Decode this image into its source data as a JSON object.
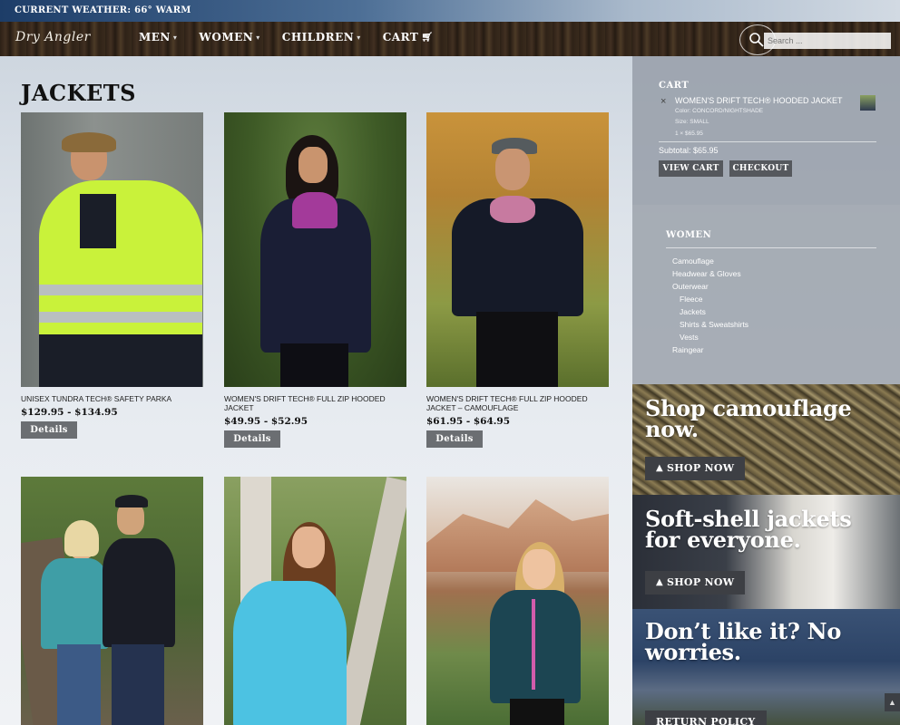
{
  "weather": {
    "text": "CURRENT WEATHER: 66° WARM"
  },
  "header": {
    "logo": "Dry Angler",
    "nav": [
      {
        "label": "MEN",
        "caret": "›"
      },
      {
        "label": "WOMEN",
        "caret": "›"
      },
      {
        "label": "CHILDREN",
        "caret": "›"
      },
      {
        "label": "CART",
        "caret": ""
      }
    ],
    "search_placeholder": "Search ..."
  },
  "main": {
    "title": "JACKETS",
    "products": [
      {
        "name": "UNISEX TUNDRA TECH® SAFETY PARKA",
        "price": "$129.95 - $134.95",
        "button": "Details"
      },
      {
        "name": "WOMEN'S DRIFT TECH® FULL ZIP HOODED JACKET",
        "price": "$49.95 - $52.95",
        "button": "Details"
      },
      {
        "name": "WOMEN'S DRIFT TECH® FULL ZIP HOODED JACKET – CAMOUFLAGE",
        "price": "$61.95 - $64.95",
        "button": "Details"
      },
      {
        "name": "",
        "price": "",
        "button": ""
      },
      {
        "name": "",
        "price": "",
        "button": ""
      },
      {
        "name": "",
        "price": "",
        "button": ""
      }
    ]
  },
  "cart_widget": {
    "title": "CART",
    "remove": "×",
    "item_name": "WOMEN'S DRIFT TECH® HOODED JACKET",
    "color": "Color: CONCORD/NIGHTSHADE",
    "size": "Size: SMALL",
    "qty_price": "1 × $65.95",
    "subtotal": "Subtotal: $65.95",
    "view_cart": "VIEW CART",
    "checkout": "CHECKOUT"
  },
  "categories": {
    "title": "WOMEN",
    "items": [
      {
        "label": "Camouflage"
      },
      {
        "label": "Headwear & Gloves"
      },
      {
        "label": "Outerwear"
      },
      {
        "label": "Fleece"
      },
      {
        "label": "Jackets"
      },
      {
        "label": "Shirts & Sweatshirts"
      },
      {
        "label": "Vests"
      },
      {
        "label": "Raingear"
      }
    ]
  },
  "promos": [
    {
      "heading_1": "Shop camouflage",
      "heading_2": "now.",
      "button": "SHOP NOW"
    },
    {
      "heading_1": "Soft-shell jackets",
      "heading_2": "for everyone.",
      "button": "SHOP NOW"
    },
    {
      "heading_1": "Don’t like it? No",
      "heading_2": "worries.",
      "button": "RETURN POLICY"
    }
  ],
  "scroll_top_icon": "chevron-up"
}
